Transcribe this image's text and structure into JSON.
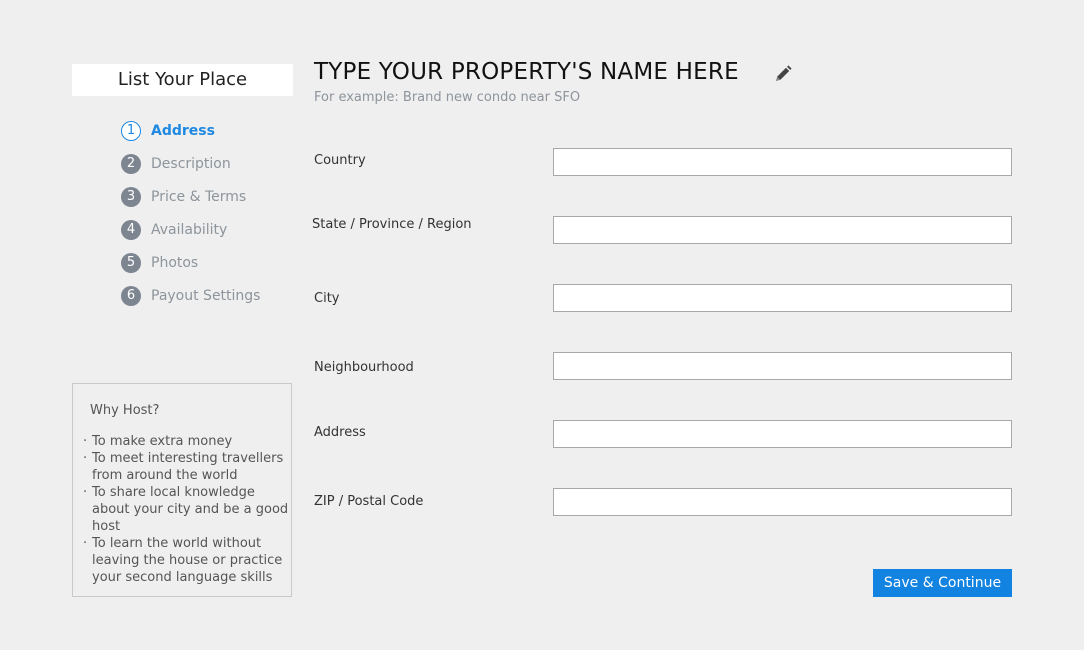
{
  "sidebar": {
    "title": "List Your Place",
    "steps": [
      {
        "num": "1",
        "label": "Address",
        "active": true
      },
      {
        "num": "2",
        "label": "Description",
        "active": false
      },
      {
        "num": "3",
        "label": "Price & Terms",
        "active": false
      },
      {
        "num": "4",
        "label": "Availability",
        "active": false
      },
      {
        "num": "5",
        "label": "Photos",
        "active": false
      },
      {
        "num": "6",
        "label": "Payout Settings",
        "active": false
      }
    ],
    "why_host": {
      "title": "Why Host?",
      "reasons": [
        "To make extra money",
        "To meet interesting travellers from around the world",
        "To share local knowledge about your city and be a good host",
        "To learn the world without leaving the house or practice your second language skills"
      ]
    }
  },
  "main": {
    "property_title": "TYPE YOUR PROPERTY'S NAME HERE",
    "property_subtitle": "For example: Brand new condo near SFO",
    "edit_icon": "pencil-icon",
    "fields": [
      {
        "label": "Country",
        "value": ""
      },
      {
        "label": "State / Province / Region",
        "value": ""
      },
      {
        "label": "City",
        "value": ""
      },
      {
        "label": "Neighbourhood",
        "value": ""
      },
      {
        "label": "Address",
        "value": ""
      },
      {
        "label": "ZIP / Postal Code",
        "value": ""
      }
    ],
    "save_label": "Save & Continue"
  },
  "colors": {
    "accent": "#1283e0",
    "background": "#efefef",
    "step_inactive": "#7d8590"
  }
}
